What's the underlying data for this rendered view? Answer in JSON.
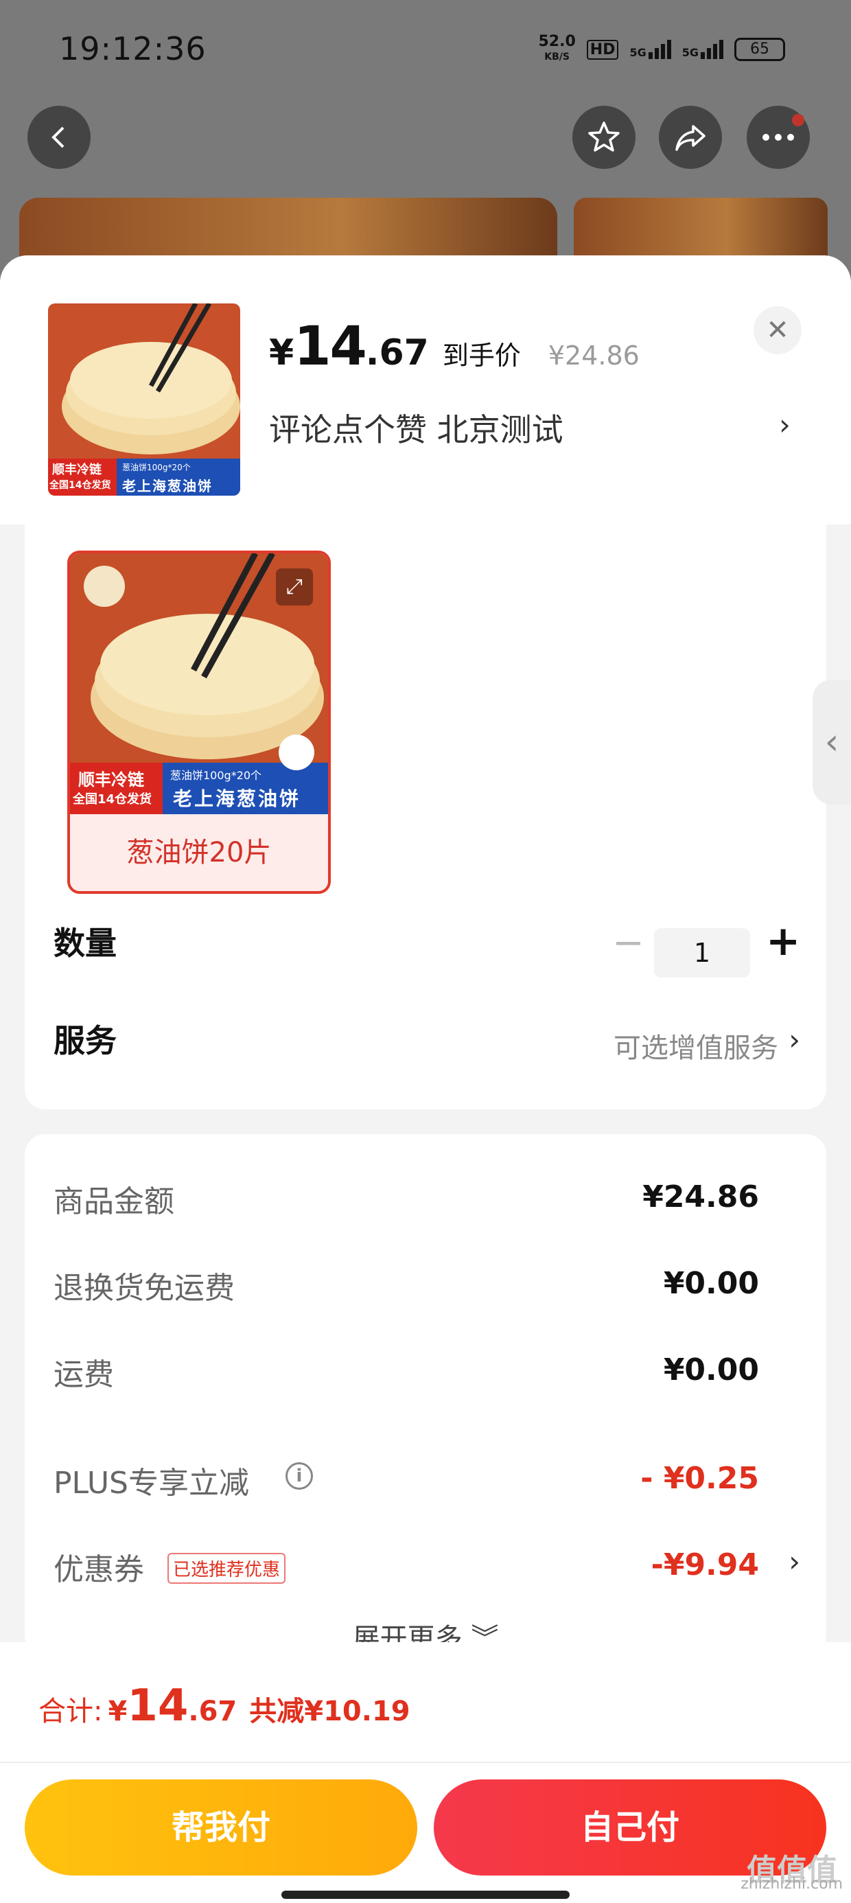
{
  "status_bar": {
    "time": "19:12:36",
    "net_speed": "52.0",
    "net_unit": "KB/S",
    "hd": "HD",
    "sig1": "5G",
    "sig2": "5G",
    "battery": "65"
  },
  "product": {
    "price_yen": "¥",
    "price_int": "14",
    "price_dec": ".67",
    "price_tag": "到手价",
    "original_price": "¥24.86",
    "address": "评论点个赞  北京测试",
    "thumb_text_left_top": "顺丰冷链",
    "thumb_text_left_bottom": "全国14仓发货",
    "thumb_text_right_top": "葱油饼100g*20个",
    "thumb_text_right_bottom": "老上海葱油饼"
  },
  "variant": {
    "label": "葱油饼20片"
  },
  "quantity": {
    "label": "数量",
    "minus": "−",
    "value": "1",
    "plus": "+"
  },
  "service": {
    "label": "服务",
    "value": "可选增值服务"
  },
  "fees": {
    "goods_label": "商品金额",
    "goods_value": "¥24.86",
    "return_label": "退换货免运费",
    "return_value": "¥0.00",
    "shipping_label": "运费",
    "shipping_value": "¥0.00",
    "plus_label": "PLUS专享立减",
    "plus_value": "- ¥0.25",
    "coupon_label": "优惠券",
    "coupon_badge": "已选推荐优惠",
    "coupon_value": "-¥9.94",
    "more": "展开更多 ︾"
  },
  "footer": {
    "total_label": "合计:",
    "total_yen": "¥",
    "total_int": "14",
    "total_dec": ".67",
    "total_saved": "共减¥10.19",
    "help_pay": "帮我付",
    "self_pay": "自己付"
  },
  "watermark": "zhizhizhi.com",
  "watermark_logo": "值值值",
  "colors": {
    "accent_red": "#e0301e",
    "help_btn": "#ffb40c",
    "self_btn": "#f5382f"
  },
  "icons": [
    "back-arrow-icon",
    "star-icon",
    "share-icon",
    "more-icon",
    "close-icon",
    "chevron-right-icon",
    "expand-icon",
    "info-icon",
    "chevron-down-icon"
  ]
}
